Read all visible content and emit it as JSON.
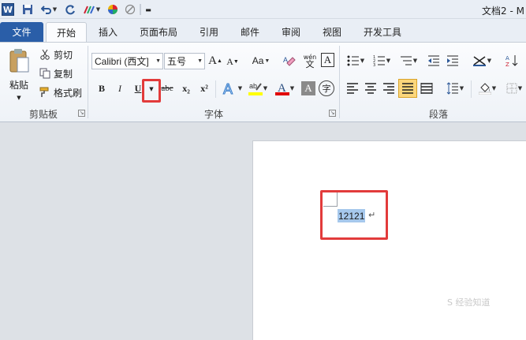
{
  "titlebar": {
    "app_icon_letter": "W",
    "title": "文档2 - M"
  },
  "tabs": [
    {
      "label": "文件"
    },
    {
      "label": "开始"
    },
    {
      "label": "插入"
    },
    {
      "label": "页面布局"
    },
    {
      "label": "引用"
    },
    {
      "label": "邮件"
    },
    {
      "label": "审阅"
    },
    {
      "label": "视图"
    },
    {
      "label": "开发工具"
    }
  ],
  "clipboard": {
    "paste_label": "粘贴",
    "cut_label": "剪切",
    "copy_label": "复制",
    "format_painter_label": "格式刷",
    "group_label": "剪贴板"
  },
  "font": {
    "font_name": "Calibri (西文]",
    "font_size": "五号",
    "grow_label": "A",
    "shrink_label": "A",
    "case_label": "Aa",
    "phonetic_label": "wén",
    "bold": "B",
    "italic": "I",
    "underline": "U",
    "strike": "abc",
    "subscript": "x₂",
    "superscript": "x²",
    "border_char": "A",
    "shade_char": "A",
    "enclose_char": "字",
    "group_label": "字体"
  },
  "paragraph": {
    "group_label": "段落"
  },
  "colors": {
    "file_tab": "#2a5ea8",
    "highlight": "#e23b3b",
    "selection": "#a6c8ec",
    "font_color_bar": "#e00000",
    "highlight_bar": "#ffff00"
  },
  "document": {
    "text": "12121",
    "paragraph_mark": "↵"
  },
  "watermark": "S 经验知道"
}
